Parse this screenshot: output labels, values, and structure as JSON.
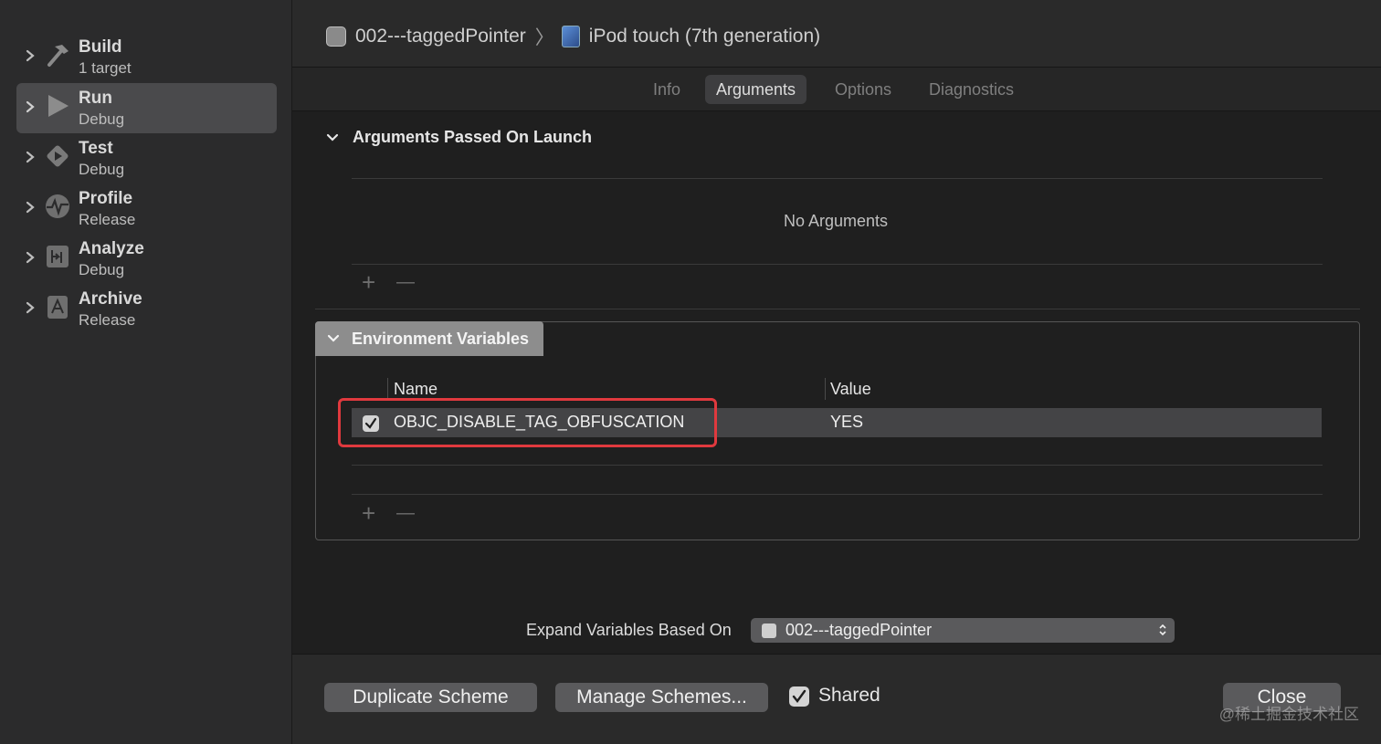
{
  "sidebar": {
    "items": [
      {
        "title": "Build",
        "subtitle": "1 target",
        "icon": "hammer-icon"
      },
      {
        "title": "Run",
        "subtitle": "Debug",
        "icon": "play-icon"
      },
      {
        "title": "Test",
        "subtitle": "Debug",
        "icon": "test-diamond-icon"
      },
      {
        "title": "Profile",
        "subtitle": "Release",
        "icon": "waveform-icon"
      },
      {
        "title": "Analyze",
        "subtitle": "Debug",
        "icon": "analyze-icon"
      },
      {
        "title": "Archive",
        "subtitle": "Release",
        "icon": "archive-icon"
      }
    ],
    "selected_index": 1
  },
  "header": {
    "scheme": "002---taggedPointer",
    "separator": "〉",
    "destination": "iPod touch (7th generation)"
  },
  "tabs": [
    "Info",
    "Arguments",
    "Options",
    "Diagnostics"
  ],
  "active_tab": "Arguments",
  "arguments": {
    "title": "Arguments Passed On Launch",
    "empty_text": "No Arguments",
    "add": "+",
    "remove": "—"
  },
  "environment": {
    "title": "Environment Variables",
    "col_name": "Name",
    "col_value": "Value",
    "rows": [
      {
        "enabled": true,
        "name": "OBJC_DISABLE_TAG_OBFUSCATION",
        "value": "YES"
      }
    ],
    "add": "+",
    "remove": "—"
  },
  "expand": {
    "label": "Expand Variables Based On",
    "value": "002---taggedPointer"
  },
  "footer": {
    "duplicate": "Duplicate Scheme",
    "manage": "Manage Schemes...",
    "shared_label": "Shared",
    "shared_checked": true,
    "close": "Close"
  },
  "watermark": "@稀土掘金技术社区",
  "colors": {
    "highlight": "#e0393e",
    "selected_sidebar": "#4a4a4c"
  }
}
